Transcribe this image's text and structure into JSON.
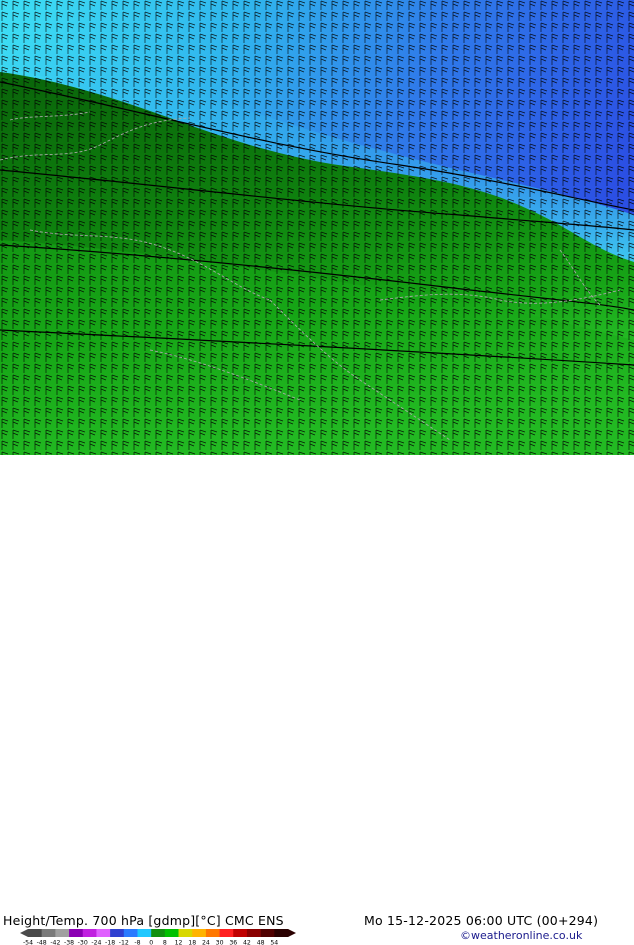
{
  "map": {
    "title": "Height/Temp. 700 hPa [gdmp][°C] CMC ENS",
    "valid_time": "Mo 15-12-2025 06:00 UTC (00+294)",
    "credit": "©weatheronline.co.uk",
    "region_style": "temperature shading with wind barbs and height contours",
    "colors": {
      "cold_blue": "#2b52e6",
      "cyan": "#33d6f0",
      "dark_green": "#0c6d0c",
      "mid_green": "#15a015",
      "bright_green": "#2ec92e",
      "barbs": "#000000",
      "borders": "#9a9a9a"
    }
  },
  "scale": {
    "labels": [
      "-54",
      "-48",
      "-42",
      "-38",
      "-30",
      "-24",
      "-18",
      "-12",
      "-8",
      "0",
      "8",
      "12",
      "18",
      "24",
      "30",
      "36",
      "42",
      "48",
      "54"
    ],
    "colors": [
      "#4a4a4a",
      "#7a7a7a",
      "#a0a0a0",
      "#8b00b3",
      "#c020e0",
      "#e060ff",
      "#3040d0",
      "#2b7bff",
      "#20c8ff",
      "#109010",
      "#00c000",
      "#d8d800",
      "#ffb400",
      "#ff7800",
      "#ff2020",
      "#c00000",
      "#8a0000",
      "#500000",
      "#2a0000"
    ]
  }
}
